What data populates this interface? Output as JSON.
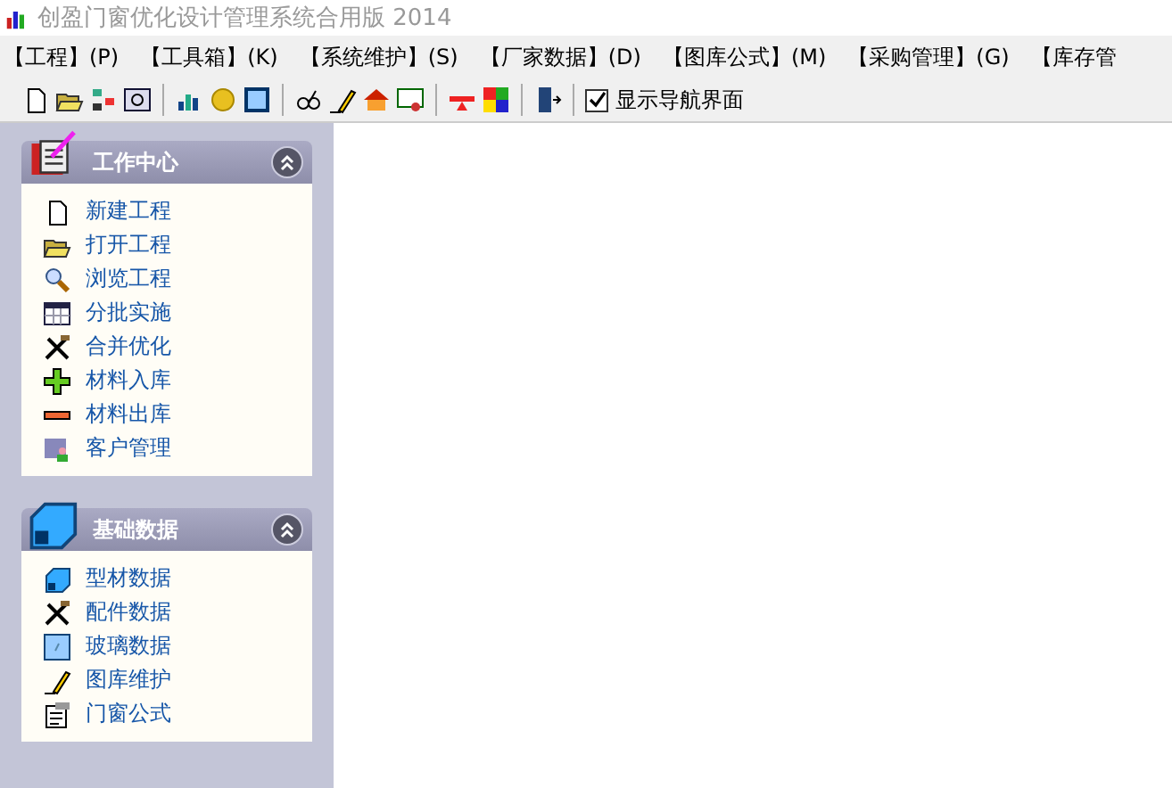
{
  "window": {
    "title": "创盈门窗优化设计管理系统合用版 2014"
  },
  "menu": [
    "【工程】(P)",
    "【工具箱】(K)",
    "【系统维护】(S)",
    "【厂家数据】(D)",
    "【图库公式】(M)",
    "【采购管理】(G)",
    "【库存管"
  ],
  "toolbar": {
    "icons": [
      {
        "kind": "new"
      },
      {
        "kind": "open"
      },
      {
        "kind": "tree"
      },
      {
        "kind": "window"
      },
      {
        "kind": "sep"
      },
      {
        "kind": "chart"
      },
      {
        "kind": "coin"
      },
      {
        "kind": "frame"
      },
      {
        "kind": "sep"
      },
      {
        "kind": "glasses"
      },
      {
        "kind": "pen"
      },
      {
        "kind": "house"
      },
      {
        "kind": "cert"
      },
      {
        "kind": "sep"
      },
      {
        "kind": "tee"
      },
      {
        "kind": "grid"
      },
      {
        "kind": "sep"
      },
      {
        "kind": "exit"
      },
      {
        "kind": "sep"
      }
    ],
    "nav_toggle": {
      "label": "显示导航界面",
      "checked": true
    }
  },
  "panels": [
    {
      "title": "工作中心",
      "kind": "book",
      "expanded": true,
      "items": [
        {
          "label": "新建工程",
          "kind": "new"
        },
        {
          "label": "打开工程",
          "kind": "open"
        },
        {
          "label": "浏览工程",
          "kind": "search"
        },
        {
          "label": "分批实施",
          "kind": "table"
        },
        {
          "label": "合并优化",
          "kind": "tools"
        },
        {
          "label": "材料入库",
          "kind": "plus"
        },
        {
          "label": "材料出库",
          "kind": "minus"
        },
        {
          "label": "客户管理",
          "kind": "user"
        }
      ]
    },
    {
      "title": "基础数据",
      "kind": "profile",
      "expanded": true,
      "items": [
        {
          "label": "型材数据",
          "kind": "profile"
        },
        {
          "label": "配件数据",
          "kind": "tools"
        },
        {
          "label": "玻璃数据",
          "kind": "glass"
        },
        {
          "label": "图库维护",
          "kind": "pen"
        },
        {
          "label": "门窗公式",
          "kind": "doc"
        }
      ]
    }
  ]
}
